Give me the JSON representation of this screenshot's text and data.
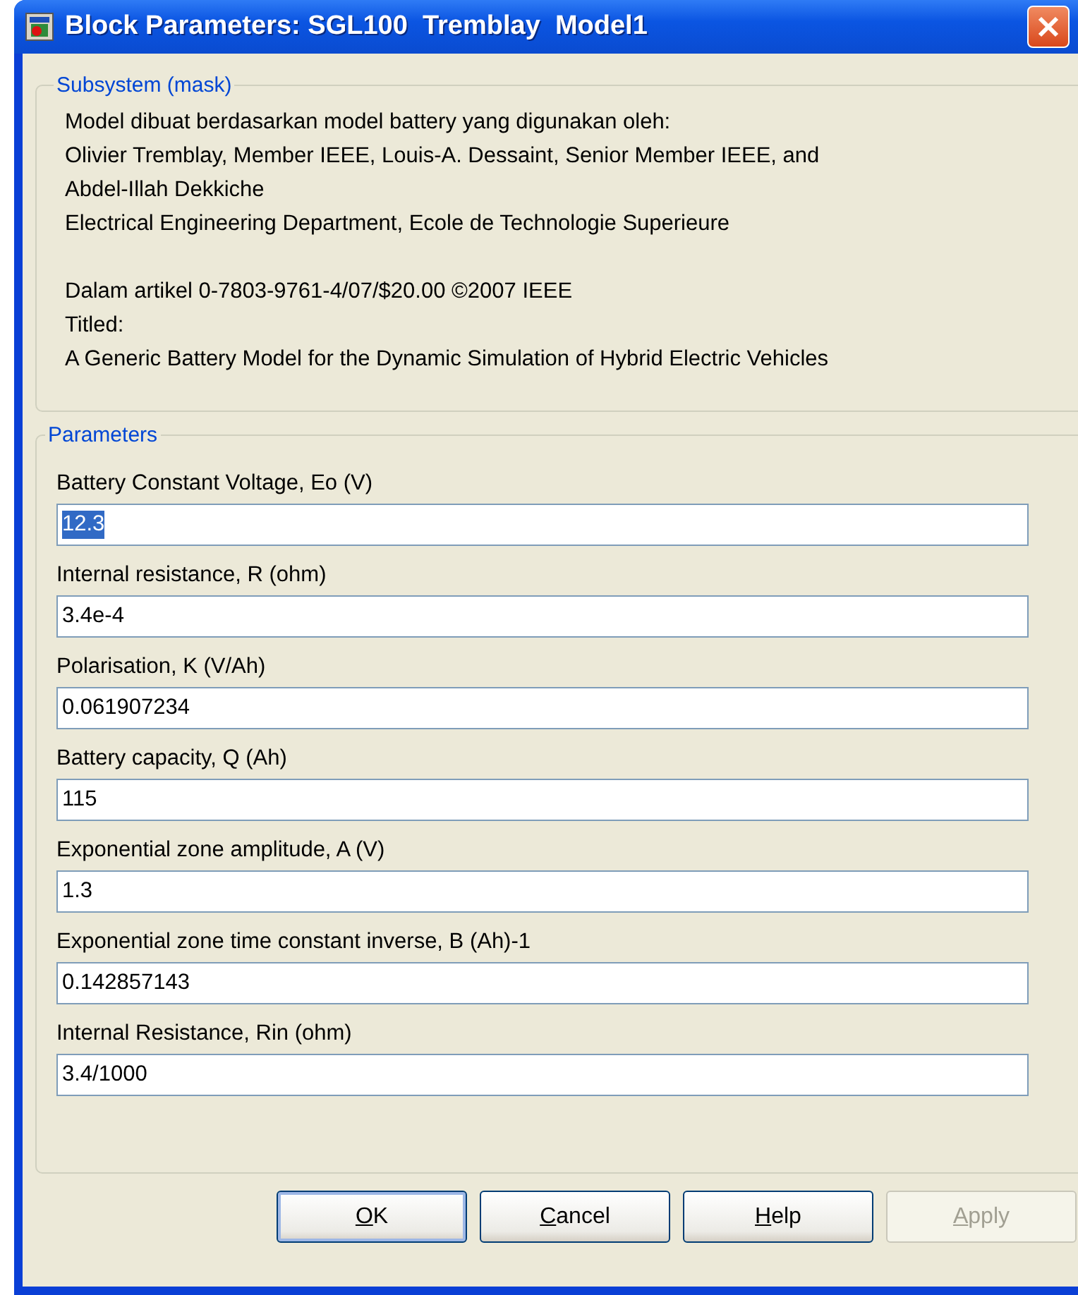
{
  "window": {
    "title": "Block Parameters: SGL100  Tremblay  Model1"
  },
  "description": {
    "title": "Subsystem (mask)",
    "paragraphs": [
      [
        "Model dibuat berdasarkan model battery yang digunakan oleh:",
        "Olivier Tremblay, Member IEEE, Louis-A. Dessaint, Senior Member IEEE, and",
        "Abdel-Illah Dekkiche",
        "Electrical Engineering Department, Ecole de Technologie Superieure"
      ],
      [
        "Dalam artikel 0-7803-9761-4/07/$20.00 ©2007 IEEE",
        "Titled:",
        "A Generic Battery Model for the Dynamic Simulation of Hybrid Electric Vehicles"
      ]
    ]
  },
  "parameters": {
    "title": "Parameters",
    "fields": [
      {
        "label": "Battery Constant Voltage, Eo (V)",
        "value": "12.3",
        "selected": true
      },
      {
        "label": "Internal resistance, R (ohm)",
        "value": "3.4e-4",
        "selected": false
      },
      {
        "label": "Polarisation, K (V/Ah)",
        "value": "0.061907234",
        "selected": false
      },
      {
        "label": "Battery capacity, Q (Ah)",
        "value": "115",
        "selected": false
      },
      {
        "label": "Exponential zone amplitude, A (V)",
        "value": "1.3",
        "selected": false
      },
      {
        "label": "Exponential zone time constant inverse, B (Ah)-1",
        "value": "0.142857143",
        "selected": false
      },
      {
        "label": "Internal Resistance, Rin (ohm)",
        "value": "3.4/1000",
        "selected": false
      }
    ]
  },
  "buttons": [
    {
      "accel": "O",
      "rest": "K",
      "default": true,
      "disabled": false
    },
    {
      "accel": "C",
      "rest": "ancel",
      "default": false,
      "disabled": false
    },
    {
      "accel": "H",
      "rest": "elp",
      "default": false,
      "disabled": false
    },
    {
      "accel": "A",
      "rest": "pply",
      "default": false,
      "disabled": true
    }
  ]
}
